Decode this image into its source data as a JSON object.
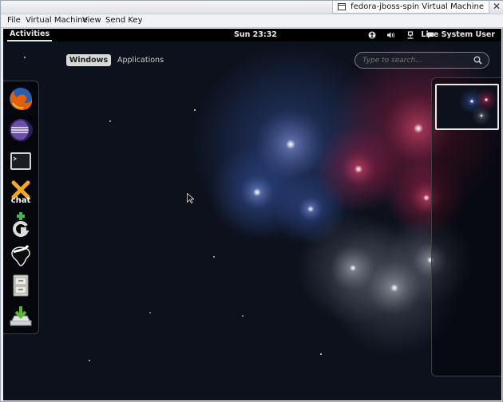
{
  "window": {
    "title": "fedora-jboss-spin Virtual Machine",
    "close_glyph": "✕"
  },
  "menubar": {
    "items": [
      "File",
      "Virtual Machine",
      "View",
      "Send Key"
    ]
  },
  "top_panel": {
    "activities": "Activities",
    "clock": "Sun 23:32",
    "tray_icons": [
      "accessibility-icon",
      "volume-icon",
      "network-icon",
      "chat-status-icon"
    ],
    "user": "Live System User"
  },
  "overview": {
    "tabs": [
      "Windows",
      "Applications"
    ],
    "active_tab": "Windows",
    "search": {
      "placeholder": "Type to search...",
      "value": ""
    }
  },
  "dash": {
    "apps": [
      "firefox-icon",
      "eclipse-icon",
      "terminal-icon",
      "xchat-icon",
      "gnome-games-icon",
      "inkscape-icon",
      "file-cabinet-icon",
      "install-to-disk-icon"
    ]
  },
  "colors": {
    "panel": "#000000",
    "background": "#0c111c",
    "firework_blue": "#3a5ab0",
    "firework_red": "#b0204a",
    "firework_white": "#c8ccd6"
  }
}
